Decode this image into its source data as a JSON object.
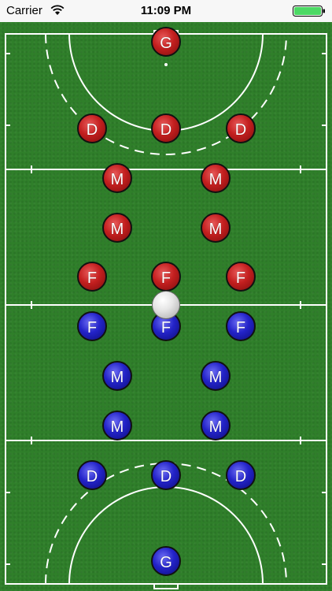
{
  "status": {
    "carrier": "Carrier",
    "time": "11:09 PM"
  },
  "colors": {
    "field": "#2f7f2a",
    "lines": "#ffffff",
    "red_team": "#c31f1f",
    "blue_team": "#2323c8",
    "battery": "#4cd964"
  },
  "players": {
    "red": {
      "goalkeeper": "G",
      "defender_left": "D",
      "defender_center": "D",
      "defender_right": "D",
      "midfielder_1": "M",
      "midfielder_2": "M",
      "midfielder_3": "M",
      "midfielder_4": "M",
      "forward_left": "F",
      "forward_center": "F",
      "forward_right": "F"
    },
    "blue": {
      "forward_left": "F",
      "forward_center": "F",
      "forward_right": "F",
      "midfielder_1": "M",
      "midfielder_2": "M",
      "midfielder_3": "M",
      "midfielder_4": "M",
      "defender_left": "D",
      "defender_center": "D",
      "defender_right": "D",
      "goalkeeper": "G"
    }
  }
}
